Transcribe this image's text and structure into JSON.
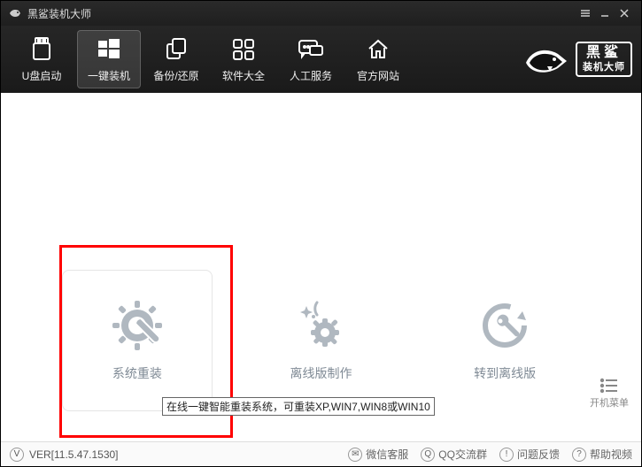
{
  "titlebar": {
    "title": "黑鲨装机大师"
  },
  "toolbar": {
    "items": [
      {
        "label": "U盘启动"
      },
      {
        "label": "一键装机"
      },
      {
        "label": "备份/还原"
      },
      {
        "label": "软件大全"
      },
      {
        "label": "人工服务"
      },
      {
        "label": "官方网站"
      }
    ]
  },
  "brand": {
    "line1": "黑鲨",
    "line2": "装机大师"
  },
  "cards": {
    "reinstall": {
      "label": "系统重装",
      "tooltip": "在线一键智能重装系统，可重装XP,WIN7,WIN8或WIN10"
    },
    "offline_make": {
      "label": "离线版制作"
    },
    "to_offline": {
      "label": "转到离线版"
    }
  },
  "boot_menu": {
    "label": "开机菜单"
  },
  "statusbar": {
    "version": "VER[11.5.47.1530]",
    "items": [
      {
        "label": "微信客服"
      },
      {
        "label": "QQ交流群"
      },
      {
        "label": "问题反馈"
      },
      {
        "label": "帮助视频"
      }
    ]
  }
}
